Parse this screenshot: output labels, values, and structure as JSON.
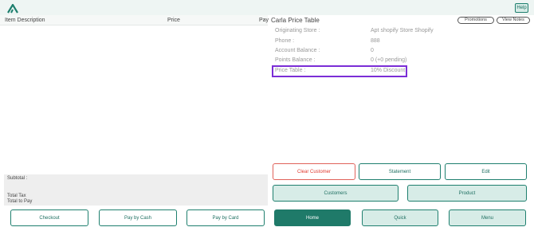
{
  "topbar": {
    "help_label": "Help"
  },
  "cart": {
    "columns": {
      "description": "Item Description",
      "price": "Price",
      "pay": "Pay"
    },
    "totals": {
      "subtotal": "Subtotal :",
      "total_tax": "Total Tax",
      "total_to_pay": "Total to Pay"
    }
  },
  "customer": {
    "name": "Carla Price Table",
    "promotions_label": "Promotions",
    "view_notes_label": "View Notes",
    "fields": [
      {
        "label": "Originating Store :",
        "value": "Apt shopify Store Shopify"
      },
      {
        "label": "Phone :",
        "value": "888"
      },
      {
        "label": "Account Balance :",
        "value": "0"
      },
      {
        "label": "Points Balance :",
        "value": "0 (+0 pending)"
      },
      {
        "label": "Price Table :",
        "value": "10% Discount"
      }
    ],
    "highlight_color": "#7b2ed6"
  },
  "actions": {
    "clear_customer": "Clear Customer",
    "statement": "Statement",
    "edit": "Edit",
    "customers": "Customers",
    "product": "Product"
  },
  "footer": {
    "checkout": "Checkout",
    "pay_cash": "Pay by Cash",
    "pay_card": "Pay by Card",
    "home": "Home",
    "quick": "Quick",
    "menu": "Menu"
  },
  "colors": {
    "accent": "#1f7a69",
    "accent_light": "#d7ece7",
    "danger": "#e0392e"
  }
}
